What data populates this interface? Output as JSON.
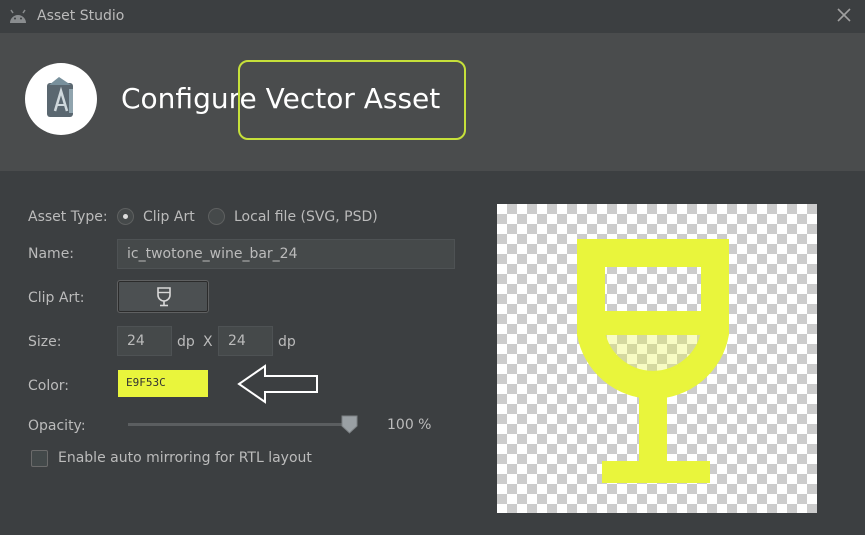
{
  "window": {
    "title": "Asset Studio"
  },
  "header": {
    "title": "Configure Vector Asset"
  },
  "form": {
    "asset_type_label": "Asset Type:",
    "asset_type_options": [
      {
        "label": "Clip Art",
        "selected": true
      },
      {
        "label": "Local file (SVG, PSD)",
        "selected": false
      }
    ],
    "name_label": "Name:",
    "name_value": "ic_twotone_wine_bar_24",
    "clip_art_label": "Clip Art:",
    "clip_art_icon": "wine-bar-icon",
    "size_label": "Size:",
    "width_value": "24",
    "height_value": "24",
    "unit": "dp",
    "size_separator": "X",
    "color_label": "Color:",
    "color_value": "E9F53C",
    "opacity_label": "Opacity:",
    "opacity_percent": 100,
    "opacity_text": "100 %",
    "mirroring_label": "Enable auto mirroring for RTL layout",
    "mirroring_checked": false
  },
  "colors": {
    "accent": "#e9f53c",
    "highlight_outline": "#c6e03a"
  }
}
